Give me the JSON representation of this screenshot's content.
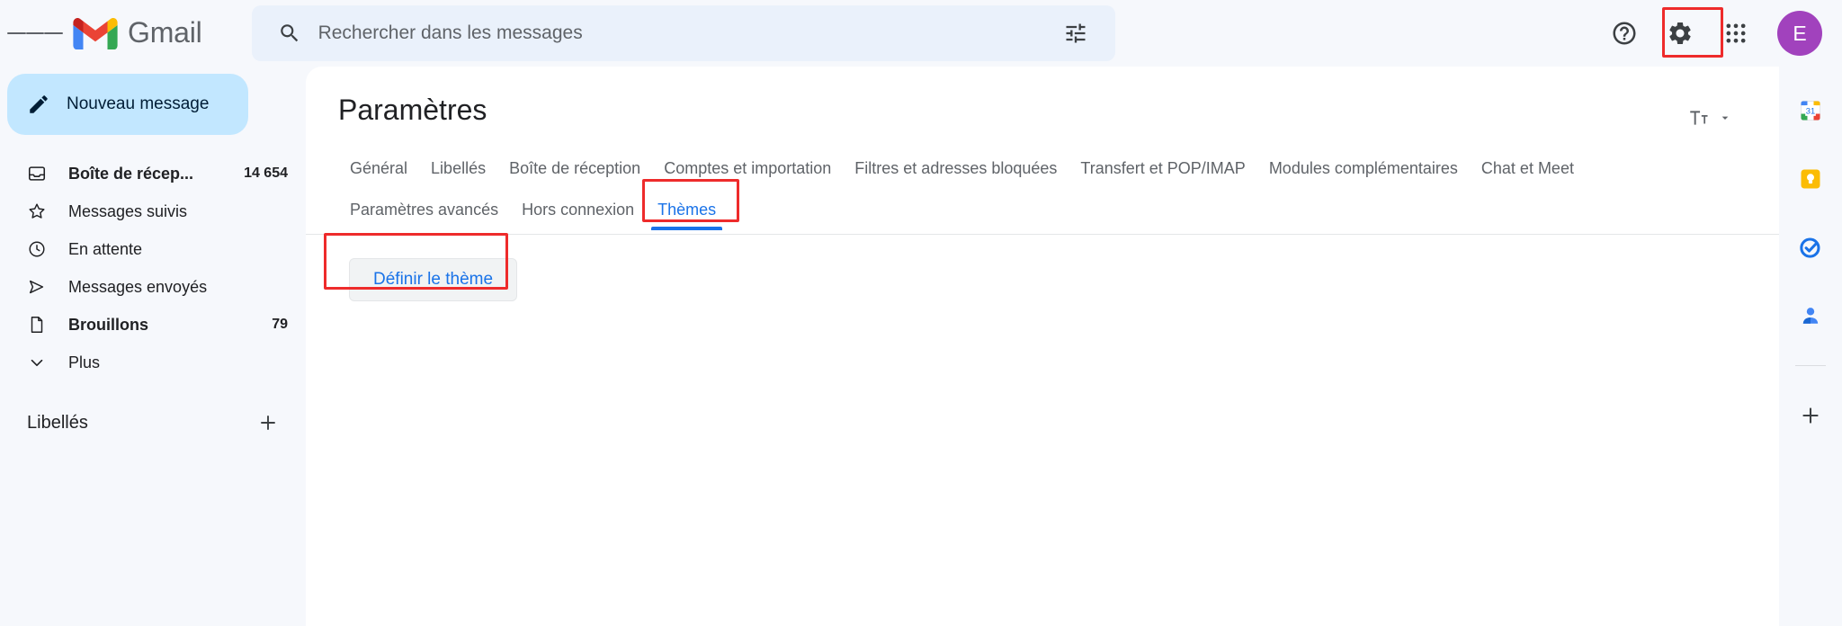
{
  "app": {
    "brand": "Gmail",
    "brand_logo_icon": "gmail-m-logo",
    "menu_icon": "hamburger-menu-icon"
  },
  "search": {
    "placeholder": "Rechercher dans les messages",
    "value": "",
    "search_icon": "search-icon",
    "options_icon": "search-options-tune-icon"
  },
  "header_actions": {
    "help_icon": "help-question-circle-icon",
    "settings_icon": "gear-settings-icon",
    "apps_icon": "google-apps-grid-icon",
    "avatar_initial": "E",
    "avatar_color": "#a142bd"
  },
  "sidebar": {
    "compose": {
      "label": "Nouveau message",
      "icon": "pencil-compose-icon"
    },
    "items": [
      {
        "label": "Boîte de récep...",
        "count": "14 654",
        "icon": "inbox-icon",
        "bold": true
      },
      {
        "label": "Messages suivis",
        "count": "",
        "icon": "star-icon",
        "bold": false
      },
      {
        "label": "En attente",
        "count": "",
        "icon": "clock-snooze-icon",
        "bold": false
      },
      {
        "label": "Messages envoyés",
        "count": "",
        "icon": "send-paper-plane-icon",
        "bold": false
      },
      {
        "label": "Brouillons",
        "count": "79",
        "icon": "draft-document-icon",
        "bold": true
      },
      {
        "label": "Plus",
        "count": "",
        "icon": "chevron-down-icon",
        "bold": false
      }
    ],
    "labels": {
      "title": "Libellés",
      "add_icon": "plus-add-label-icon"
    }
  },
  "main": {
    "title": "Paramètres",
    "density": {
      "icon": "text-density-icon",
      "chevron": "chevron-down-icon"
    },
    "tabs_row1": [
      {
        "label": "Général",
        "active": false
      },
      {
        "label": "Libellés",
        "active": false
      },
      {
        "label": "Boîte de réception",
        "active": false
      },
      {
        "label": "Comptes et importation",
        "active": false
      },
      {
        "label": "Filtres et adresses bloquées",
        "active": false
      },
      {
        "label": "Transfert et POP/IMAP",
        "active": false
      },
      {
        "label": "Modules complémentaires",
        "active": false
      },
      {
        "label": "Chat et Meet",
        "active": false
      }
    ],
    "tabs_row2": [
      {
        "label": "Paramètres avancés",
        "active": false
      },
      {
        "label": "Hors connexion",
        "active": false
      },
      {
        "label": "Thèmes",
        "active": true
      }
    ],
    "theme_button": "Définir le thème"
  },
  "right_rail": {
    "items": [
      {
        "icon": "google-calendar-icon",
        "badge": "31"
      },
      {
        "icon": "google-keep-icon",
        "badge": ""
      },
      {
        "icon": "google-tasks-icon",
        "badge": ""
      },
      {
        "icon": "google-contacts-icon",
        "badge": ""
      }
    ],
    "add_icon": "plus-add-addon-icon"
  },
  "annotations": {
    "highlight_color": "#ee2b2b",
    "boxes": [
      {
        "name": "settings-gear-highlight"
      },
      {
        "name": "themes-tab-highlight"
      },
      {
        "name": "theme-button-highlight"
      }
    ]
  },
  "colors": {
    "accent_blue": "#1a73e8",
    "compose_blue": "#c2e7ff",
    "page_bg": "#f6f8fc",
    "panel_bg": "#ffffff",
    "search_bg": "#eaf1fb"
  }
}
